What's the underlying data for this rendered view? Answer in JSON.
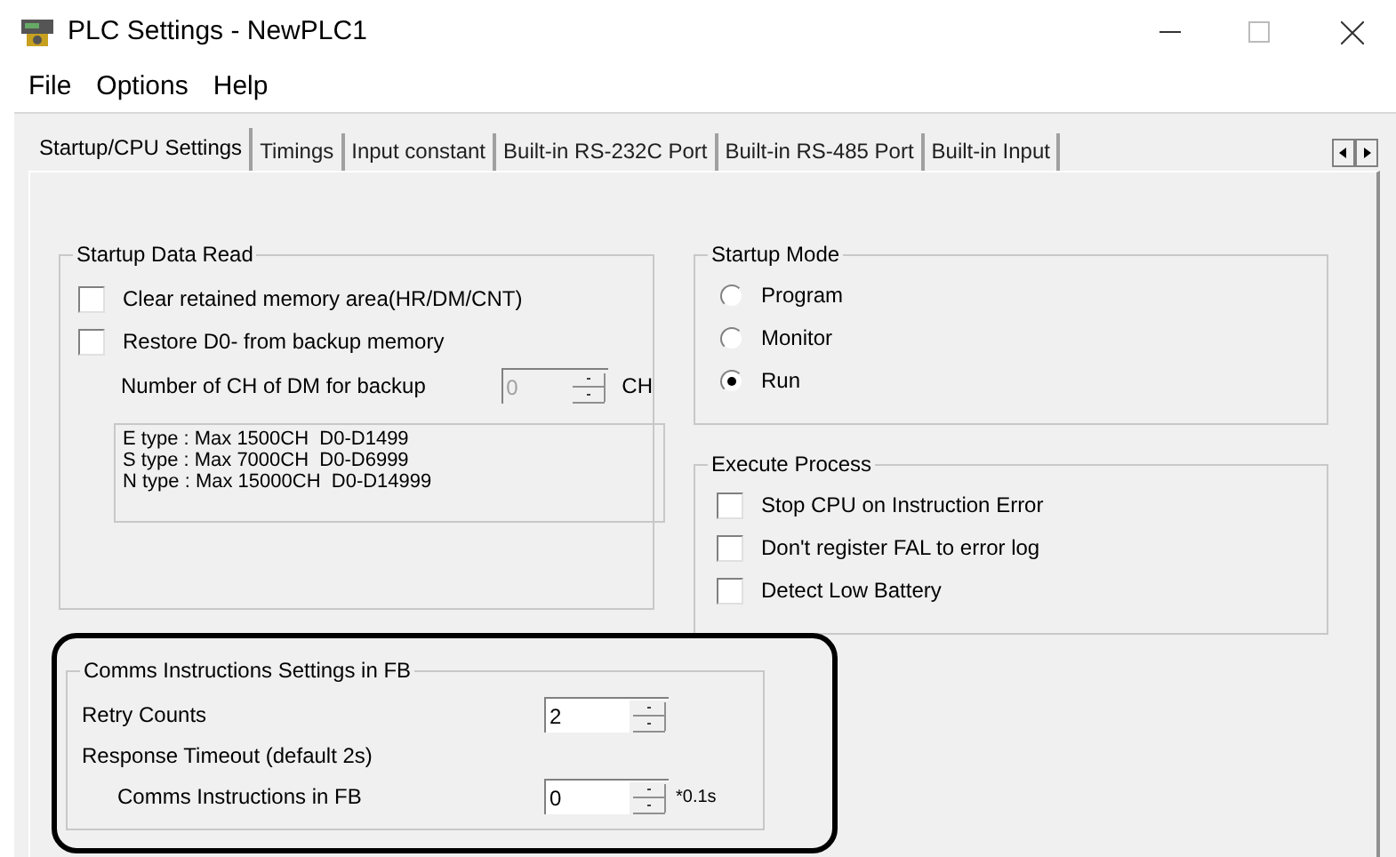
{
  "window": {
    "title": "PLC Settings - NewPLC1"
  },
  "menu": [
    "File",
    "Options",
    "Help"
  ],
  "tabs": [
    {
      "label": "Startup/CPU Settings",
      "selected": true
    },
    {
      "label": "Timings",
      "selected": false
    },
    {
      "label": "Input constant",
      "selected": false
    },
    {
      "label": "Built-in RS-232C Port",
      "selected": false
    },
    {
      "label": "Built-in RS-485 Port",
      "selected": false
    },
    {
      "label": "Built-in Input",
      "selected": false
    }
  ],
  "startup_data_read": {
    "title": "Startup Data Read",
    "options": [
      {
        "label": "Clear retained memory area(HR/DM/CNT)",
        "checked": false
      },
      {
        "label": "Restore D0- from backup memory",
        "checked": false
      }
    ],
    "backup_ch": {
      "label": "Number of CH of DM for backup",
      "value": "0",
      "unit": "CH",
      "disabled": true
    },
    "info": [
      "E type : Max 1500CH  D0-D1499",
      "S type : Max 7000CH  D0-D6999",
      "N type : Max 15000CH  D0-D14999"
    ]
  },
  "startup_mode": {
    "title": "Startup Mode",
    "options": [
      {
        "label": "Program",
        "selected": false
      },
      {
        "label": "Monitor",
        "selected": false
      },
      {
        "label": "Run",
        "selected": true
      }
    ]
  },
  "execute_process": {
    "title": "Execute Process",
    "options": [
      {
        "label": "Stop CPU on Instruction Error",
        "checked": false
      },
      {
        "label": "Don't register FAL to error log",
        "checked": false
      },
      {
        "label": "Detect Low Battery",
        "checked": false
      }
    ]
  },
  "comms": {
    "title": "Comms Instructions Settings in FB",
    "retry": {
      "label": "Retry Counts",
      "value": "2"
    },
    "timeout_label": "Response Timeout (default 2s)",
    "timeout": {
      "label": "Comms Instructions in FB",
      "value": "0",
      "unit": "*0.1s"
    }
  }
}
